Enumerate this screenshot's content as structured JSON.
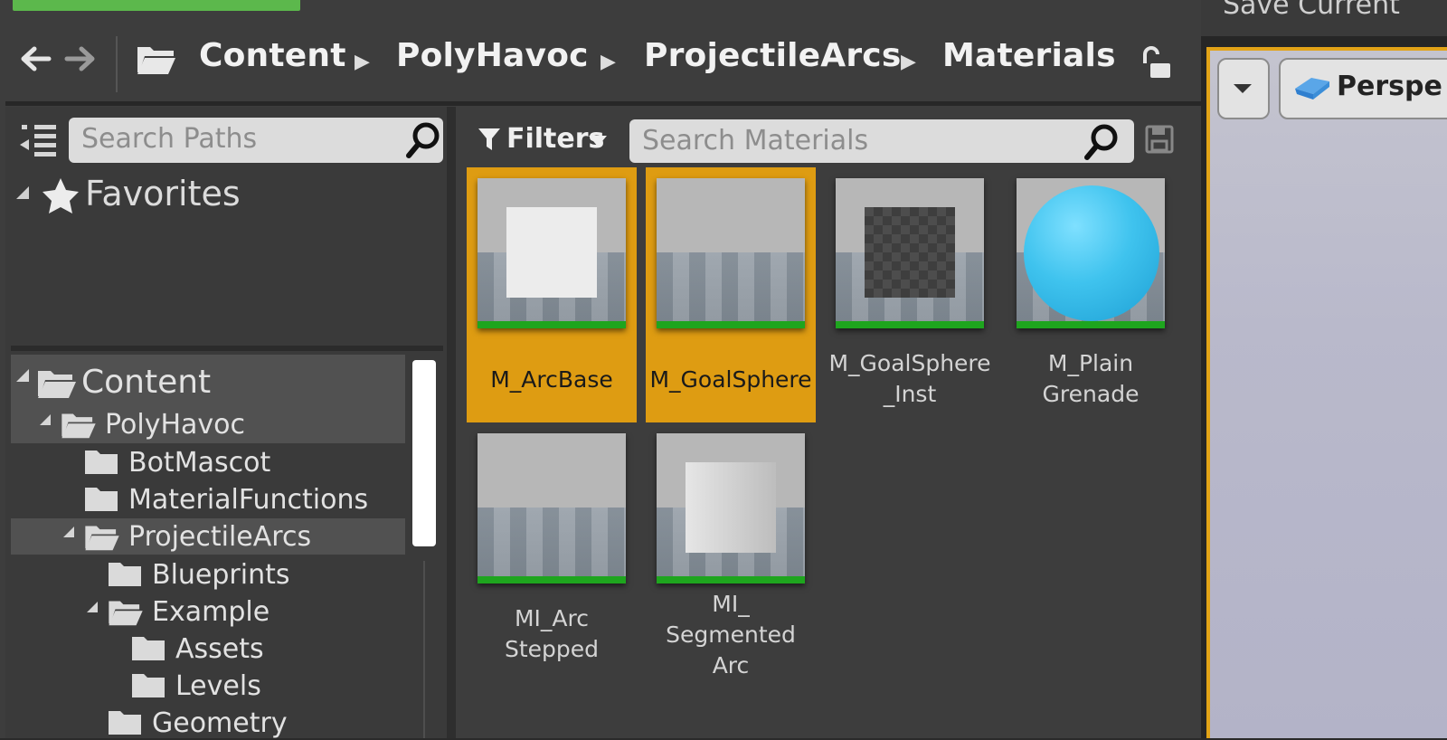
{
  "breadcrumb": {
    "items": [
      "Content",
      "PolyHavoc",
      "ProjectileArcs",
      "Materials"
    ]
  },
  "sources": {
    "search_placeholder": "Search Paths",
    "favorites_label": "Favorites",
    "tree": [
      {
        "label": "Content",
        "depth": 0,
        "expanded": true
      },
      {
        "label": "PolyHavoc",
        "depth": 1,
        "expanded": true
      },
      {
        "label": "BotMascot",
        "depth": 2,
        "expanded": false
      },
      {
        "label": "MaterialFunctions",
        "depth": 2,
        "expanded": false
      },
      {
        "label": "ProjectileArcs",
        "depth": 2,
        "expanded": true
      },
      {
        "label": "Blueprints",
        "depth": 3,
        "expanded": false
      },
      {
        "label": "Example",
        "depth": 3,
        "expanded": true
      },
      {
        "label": "Assets",
        "depth": 4,
        "expanded": false
      },
      {
        "label": "Levels",
        "depth": 4,
        "expanded": false
      },
      {
        "label": "Geometry",
        "depth": 3,
        "expanded": false
      }
    ]
  },
  "assets": {
    "filters_label": "Filters",
    "search_placeholder": "Search Materials",
    "items": [
      {
        "label": "M_ArcBase",
        "selected": true,
        "thumb": "square-white"
      },
      {
        "label": "M_GoalSphere",
        "selected": true,
        "thumb": "plain"
      },
      {
        "label": "M_GoalSphere\n_Inst",
        "selected": false,
        "thumb": "square-checker"
      },
      {
        "label": "M_Plain\nGrenade",
        "selected": false,
        "thumb": "sphere"
      },
      {
        "label": "MI_Arc\nStepped",
        "selected": false,
        "thumb": "plain"
      },
      {
        "label": "MI_\nSegmented\nArc",
        "selected": false,
        "thumb": "gradient"
      }
    ]
  },
  "viewport": {
    "top_text": "Save Current",
    "mode_label": "Perspe"
  },
  "colors": {
    "selection": "#de9c12",
    "type_bar": "#1ea51e",
    "sphere": "#3fc3ee"
  }
}
